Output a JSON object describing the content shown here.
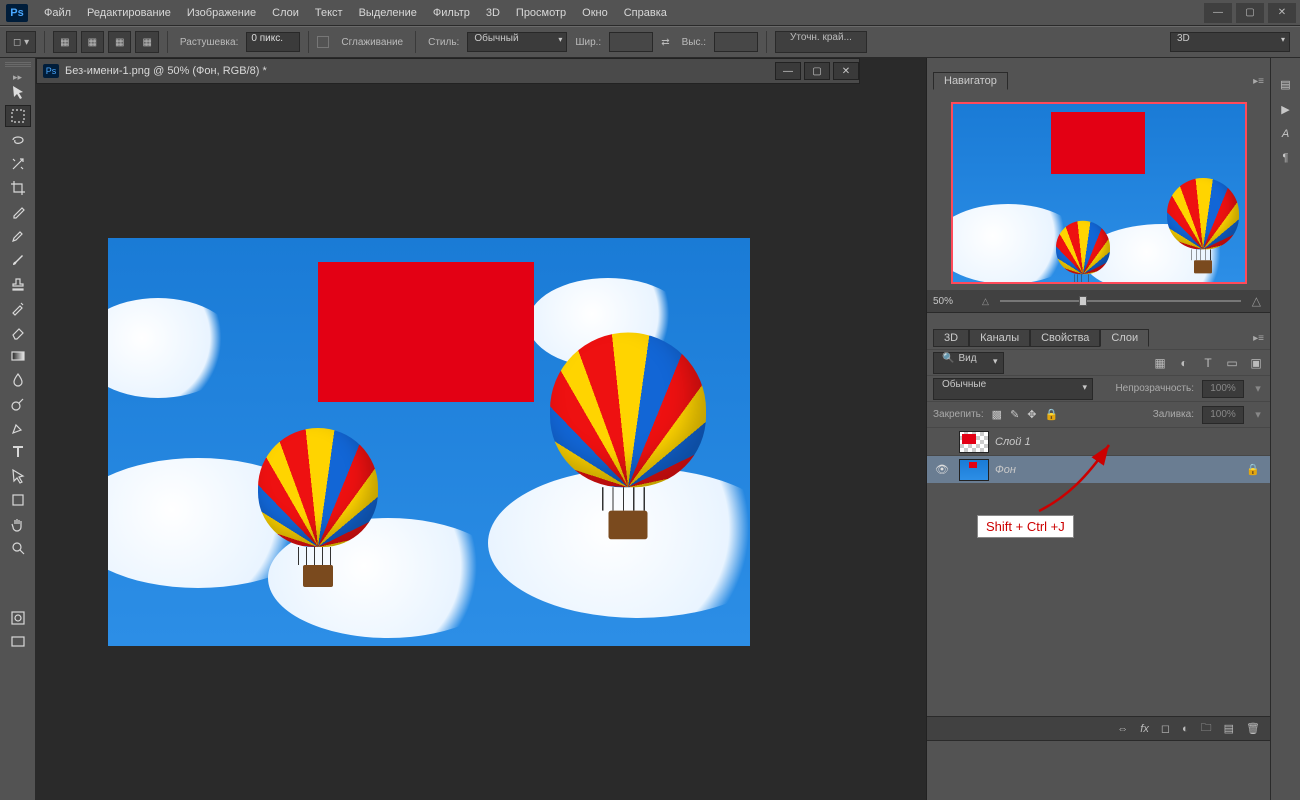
{
  "menu": [
    "Файл",
    "Редактирование",
    "Изображение",
    "Слои",
    "Текст",
    "Выделение",
    "Фильтр",
    "3D",
    "Просмотр",
    "Окно",
    "Справка"
  ],
  "options": {
    "feather_label": "Растушевка:",
    "feather_value": "0 пикс.",
    "antialias": "Сглаживание",
    "style_label": "Стиль:",
    "style_value": "Обычный",
    "width_label": "Шир.:",
    "height_label": "Выс.:",
    "refine": "Уточн. край...",
    "w3d": "3D"
  },
  "doc": {
    "title": "Без-имени-1.png @ 50% (Фон, RGB/8) *"
  },
  "navigator": {
    "title": "Навигатор",
    "zoom": "50%"
  },
  "layers_panel": {
    "tabs": [
      "3D",
      "Каналы",
      "Свойства",
      "Слои"
    ],
    "kind": "Вид",
    "blend": "Обычные",
    "opacity_label": "Непрозрачность:",
    "opacity": "100%",
    "lock_label": "Закрепить:",
    "fill_label": "Заливка:",
    "fill": "100%",
    "layers": [
      {
        "name": "Слой 1",
        "visible": false,
        "locked": false
      },
      {
        "name": "Фон",
        "visible": true,
        "locked": true
      }
    ],
    "shortcut": "Shift + Ctrl +J"
  },
  "tools": [
    "move",
    "marquee",
    "lasso",
    "wand",
    "crop",
    "eyedropper",
    "heal",
    "brush",
    "stamp",
    "history",
    "eraser",
    "gradient",
    "blur",
    "dodge",
    "pen",
    "type",
    "path",
    "shape",
    "hand",
    "zoom"
  ]
}
